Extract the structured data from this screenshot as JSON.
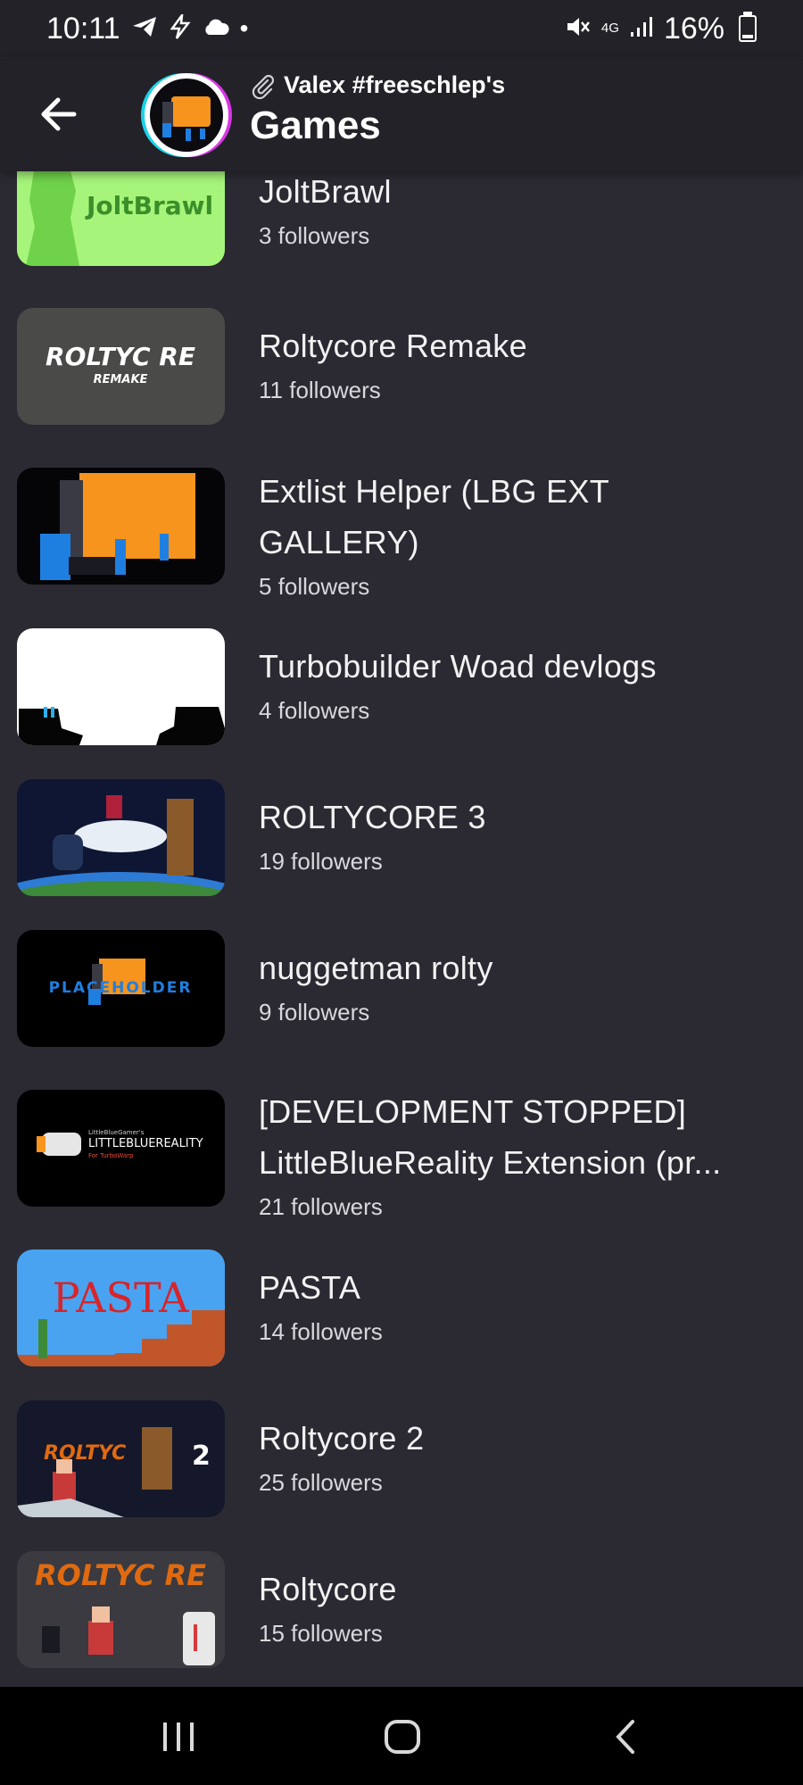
{
  "status": {
    "time": "10:11",
    "network": "4G",
    "battery": "16%"
  },
  "header": {
    "owner": "Valex #freeschlep's",
    "title": "Games"
  },
  "games": [
    {
      "title": "JoltBrawl",
      "followers": "3 followers",
      "thumb_text": "JoltBrawl"
    },
    {
      "title": "Roltycore Remake",
      "followers": "11 followers",
      "thumb_text": "ROLTYC RE",
      "thumb_sub": "REMAKE"
    },
    {
      "title": "Extlist Helper (LBG EXT GALLERY)",
      "followers": "5 followers"
    },
    {
      "title": "Turbobuilder Woad devlogs",
      "followers": "4 followers"
    },
    {
      "title": "ROLTYCORE 3",
      "followers": "19 followers"
    },
    {
      "title": "nuggetman rolty",
      "followers": "9 followers",
      "thumb_text": "PLACEHOLDER"
    },
    {
      "title": "[DEVELOPMENT STOPPED] LittleBlueReality Extension (pr...",
      "followers": "21 followers",
      "thumb_text": "LITTLEBLUEREALITY",
      "thumb_small": "LittleBlueGamer's",
      "thumb_sub": "For TurboWarp"
    },
    {
      "title": "PASTA",
      "followers": "14 followers",
      "thumb_text": "PASTA"
    },
    {
      "title": "Roltycore 2",
      "followers": "25 followers",
      "thumb_text": "ROLTYC",
      "thumb_sub": "2"
    },
    {
      "title": "Roltycore",
      "followers": "15 followers",
      "thumb_text": "ROLTYC RE"
    }
  ],
  "colors": {
    "background": "#2b2a33",
    "header": "#232228",
    "accent_orange": "#f7941d",
    "accent_blue": "#1f7fe0"
  }
}
